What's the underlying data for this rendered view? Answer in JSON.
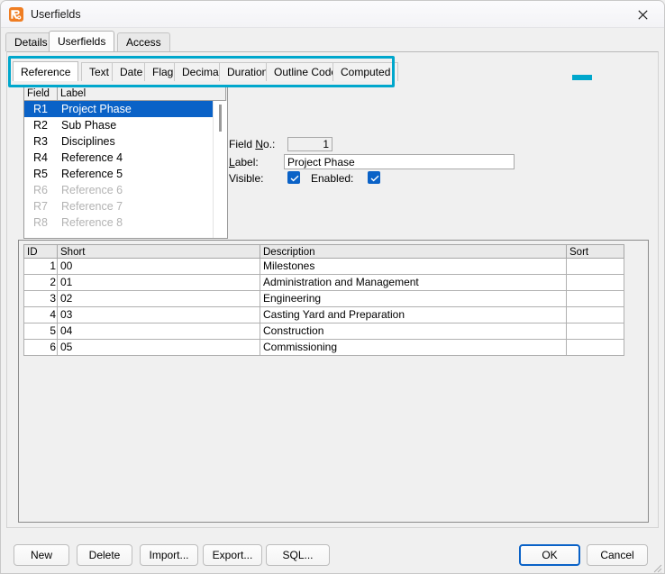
{
  "window": {
    "title": "Userfields",
    "app_icon": "app-logo-icon",
    "close_icon": "close-icon"
  },
  "outer_tabs": [
    {
      "label": "Details",
      "active": false
    },
    {
      "label": "Userfields",
      "active": true
    },
    {
      "label": "Access",
      "active": false
    }
  ],
  "inner_tabs": [
    {
      "label": "Reference",
      "active": true
    },
    {
      "label": "Text",
      "active": false
    },
    {
      "label": "Date",
      "active": false
    },
    {
      "label": "Flag",
      "active": false
    },
    {
      "label": "Decimal",
      "active": false
    },
    {
      "label": "Duration",
      "active": false
    },
    {
      "label": "Outline Codes",
      "active": false
    },
    {
      "label": "Computed",
      "active": false
    }
  ],
  "annotation": {
    "highlight_color": "#00a7cc",
    "marker_color": "#00a7cc"
  },
  "field_list": {
    "columns": [
      "Field",
      "Label"
    ],
    "rows": [
      {
        "code": "R1",
        "label": "Project Phase",
        "selected": true,
        "disabled": false
      },
      {
        "code": "R2",
        "label": "Sub Phase",
        "selected": false,
        "disabled": false
      },
      {
        "code": "R3",
        "label": "Disciplines",
        "selected": false,
        "disabled": false
      },
      {
        "code": "R4",
        "label": "Reference 4",
        "selected": false,
        "disabled": false
      },
      {
        "code": "R5",
        "label": "Reference 5",
        "selected": false,
        "disabled": false
      },
      {
        "code": "R6",
        "label": "Reference 6",
        "selected": false,
        "disabled": true
      },
      {
        "code": "R7",
        "label": "Reference 7",
        "selected": false,
        "disabled": true
      },
      {
        "code": "R8",
        "label": "Reference 8",
        "selected": false,
        "disabled": true
      }
    ]
  },
  "detail": {
    "field_no_label": "Field No.:",
    "field_no_value": "1",
    "label_label": "Label:",
    "label_value": "Project Phase",
    "visible_label": "Visible:",
    "visible_checked": true,
    "enabled_label": "Enabled:",
    "enabled_checked": true,
    "checkbox_color": "#0a62c7"
  },
  "grid": {
    "columns": [
      "ID",
      "Short",
      "Description",
      "Sort"
    ],
    "rows": [
      {
        "id": "1",
        "short": "00",
        "description": "Milestones",
        "sort": ""
      },
      {
        "id": "2",
        "short": "01",
        "description": "Administration and Management",
        "sort": ""
      },
      {
        "id": "3",
        "short": "02",
        "description": "Engineering",
        "sort": ""
      },
      {
        "id": "4",
        "short": "03",
        "description": "Casting Yard and Preparation",
        "sort": ""
      },
      {
        "id": "5",
        "short": "04",
        "description": "Construction",
        "sort": ""
      },
      {
        "id": "6",
        "short": "05",
        "description": "Commissioning",
        "sort": ""
      }
    ]
  },
  "buttons": {
    "new": "New",
    "delete": "Delete",
    "import": "Import...",
    "export": "Export...",
    "sql": "SQL...",
    "ok": "OK",
    "cancel": "Cancel"
  }
}
